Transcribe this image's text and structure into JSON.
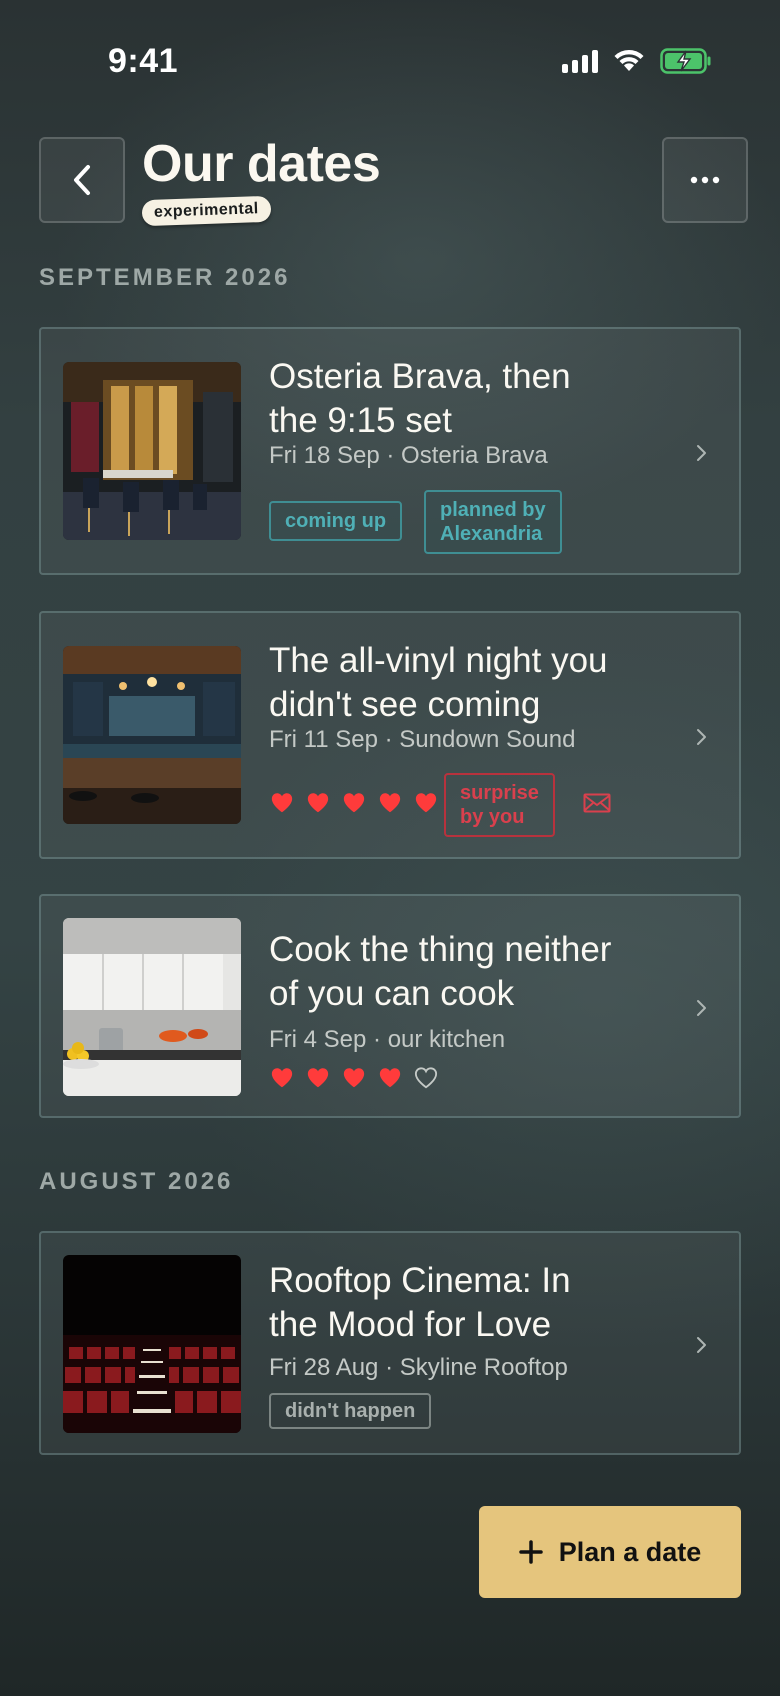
{
  "status_bar": {
    "time": "9:41"
  },
  "header": {
    "title": "Our dates",
    "badge": "experimental"
  },
  "sections": [
    {
      "label": "SEPTEMBER 2026",
      "dates": [
        {
          "title_line1": "Osteria Brava, then",
          "title_line2": "the 9:15 set",
          "subtitle": "Fri 18 Sep · Osteria Brava",
          "tags": [
            "coming up",
            "planned by",
            "Alexandria"
          ]
        },
        {
          "title_line1": "The all-vinyl night you",
          "title_line2": "didn't see coming",
          "subtitle": "Fri 11 Sep · Sundown Sound",
          "rating": 5,
          "rating_max": 5,
          "tags": [
            "surprise",
            "by you"
          ],
          "icon": "envelope-icon"
        },
        {
          "title_line1": "Cook the thing neither",
          "title_line2": "of you can cook",
          "subtitle": "Fri 4 Sep · our kitchen",
          "rating": 4,
          "rating_max": 5
        }
      ]
    },
    {
      "label": "AUGUST 2026",
      "dates": [
        {
          "title_line1": "Rooftop Cinema: In",
          "title_line2": "the Mood for Love",
          "subtitle": "Fri 28 Aug · Skyline Rooftop",
          "tags": [
            "didn't happen"
          ]
        }
      ]
    }
  ],
  "fab": {
    "label": "Plan a date",
    "icon": "plus-icon"
  },
  "colors": {
    "accent": "#e5c57d",
    "teal": "#4fb0b6",
    "red": "#d9404d",
    "heart": "#ff3b3b"
  }
}
